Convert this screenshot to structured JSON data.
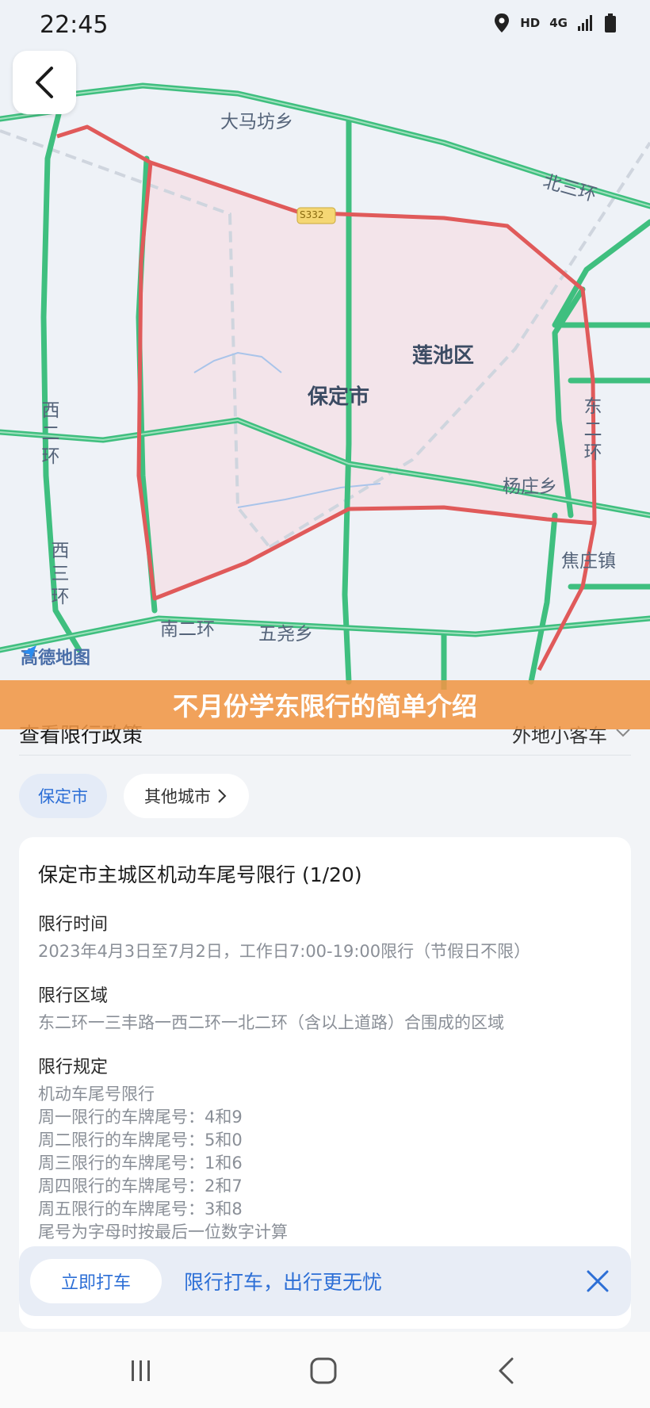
{
  "status_bar": {
    "time": "22:45",
    "hd_label": "HD",
    "network_label": "4G"
  },
  "map": {
    "labels": {
      "damafang": "大马坊乡",
      "beisanhuan": "北三环",
      "lianchi": "莲池区",
      "baoding": "保定市",
      "xierhuan": "西二环",
      "dongerhuan": "东二环",
      "yangzhuang": "杨庄乡",
      "xisanhuan": "西三环",
      "jiaozhuang": "焦庄镇",
      "nanerhuan": "南二环",
      "wuyao": "五尧乡",
      "road_shield": "S332"
    },
    "logo_text": "高德地图"
  },
  "banner": {
    "text": "不月份学东限行的简单介绍"
  },
  "panel": {
    "policy_title": "查看限行政策",
    "vehicle_type": "外地小客车",
    "city_tabs": {
      "active": "保定市",
      "other": "其他城市"
    },
    "card": {
      "title": "保定市主城区机动车尾号限行 (1/20)",
      "time_heading": "限行时间",
      "time_text": "2023年4月3日至7月2日，工作日7:00-19:00限行（节假日不限）",
      "area_heading": "限行区域",
      "area_text": "东二环一三丰路一西二环一北二环（含以上道路）合围成的区域",
      "rule_heading": "限行规定",
      "rules": [
        "机动车尾号限行",
        "周一限行的车牌尾号：4和9",
        "周二限行的车牌尾号：5和0",
        "周三限行的车牌尾号：1和6",
        "周四限行的车牌尾号：2和7",
        "周五限行的车牌尾号：3和8",
        "尾号为字母时按最后一位数字计算"
      ]
    },
    "promo": {
      "button": "立即打车",
      "text": "限行打车，出行更无忧"
    }
  },
  "colors": {
    "accent": "#2d6fd6",
    "road": "#3fbf7f",
    "zone_border": "#e05a5a",
    "banner": "#f0964a"
  }
}
